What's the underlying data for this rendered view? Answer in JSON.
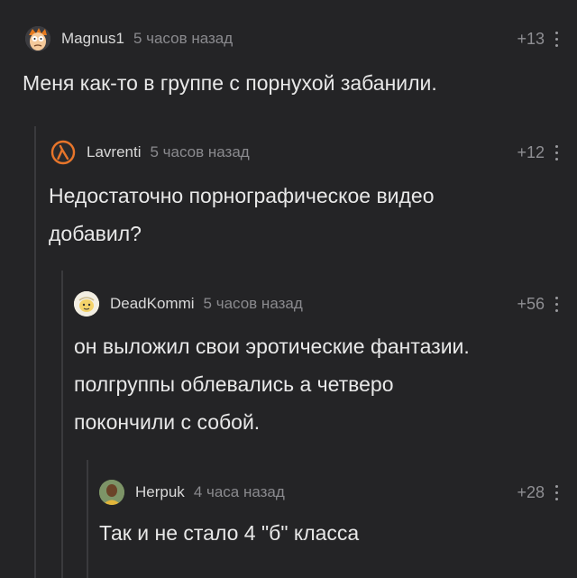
{
  "comments": [
    {
      "username": "Magnus1",
      "time": "5 часов назад",
      "rating": "+13",
      "text": "Меня как-то в группе с порнухой забанили.",
      "avatar": "fry-face-icon"
    },
    {
      "username": "Lavrenti",
      "time": "5 часов назад",
      "rating": "+12",
      "text": "Недостаточно порнографическое видео\nдобавил?",
      "avatar": "half-life-lambda-icon"
    },
    {
      "username": "DeadKommi",
      "time": "5 часов назад",
      "rating": "+56",
      "text": "он выложил свои эротические фантазии.\nполгруппы облевались а четверо\nпокончили с собой.",
      "avatar": "cartoon-avatar-icon"
    },
    {
      "username": "Herpuk",
      "time": "4 часа назад",
      "rating": "+28",
      "text": "Так и не стало 4 \"б\" класса",
      "avatar": "user-photo-avatar"
    }
  ],
  "colors": {
    "background": "#242426",
    "thread_line": "#3a3a3d",
    "text": "#e8e8e8",
    "muted": "#8a8a8e"
  }
}
